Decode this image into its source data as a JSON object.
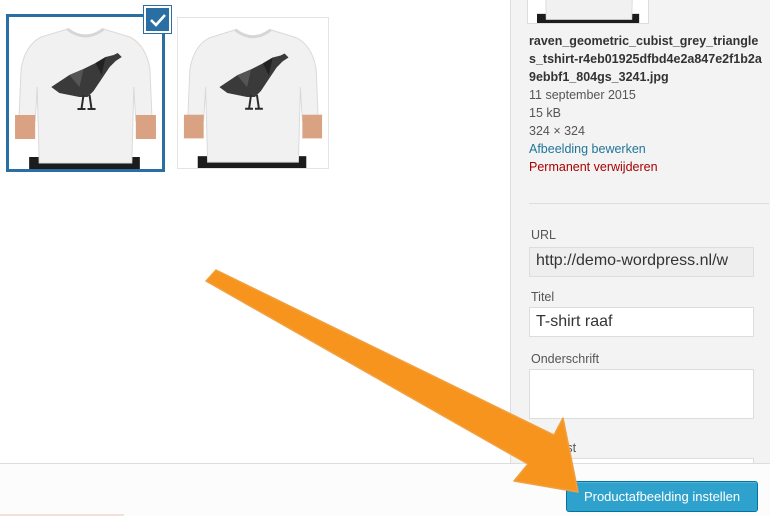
{
  "attachments": [
    {
      "name": "raven-tshirt-1",
      "selected": true
    },
    {
      "name": "raven-tshirt-2",
      "selected": false
    }
  ],
  "details": {
    "filename": "raven_geometric_cubist_grey_triangles_tshirt-r4eb01925dfbd4e2a847e2f1b2a9ebbf1_804gs_3241.jpg",
    "date": "11 september 2015",
    "size": "15 kB",
    "dimensions": "324 × 324",
    "edit_link": "Afbeelding bewerken",
    "delete_link": "Permanent verwijderen"
  },
  "fields": {
    "url_label": "URL",
    "url_value": "http://demo-wordpress.nl/w",
    "title_label": "Titel",
    "title_value": "T-shirt raaf",
    "caption_label": "Onderschrift",
    "caption_value": "",
    "alt_label": "Alt-tekst",
    "alt_value": ""
  },
  "footer": {
    "button_label": "Productafbeelding instellen"
  },
  "colors": {
    "selection": "#2a6fa3",
    "primary_button": "#2ea2cc",
    "link": "#21759b",
    "delete": "#aa0000",
    "arrow": "#f7941d"
  },
  "icons": {
    "check": "checkmark-icon",
    "arrow": "pointer-arrow"
  }
}
